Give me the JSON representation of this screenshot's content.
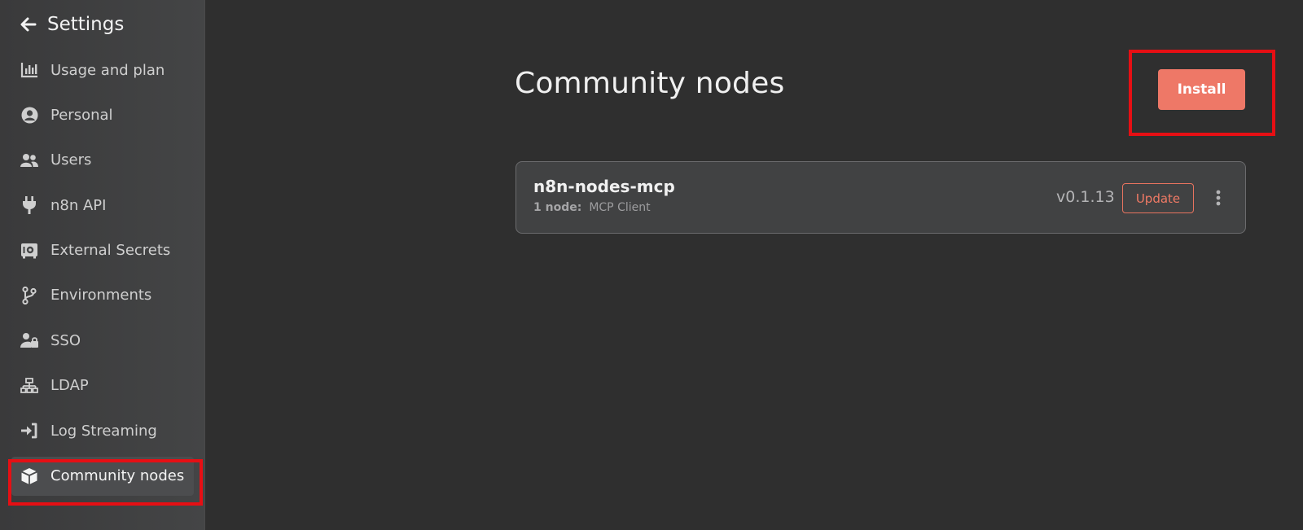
{
  "sidebar": {
    "title": "Settings",
    "back_icon": "arrow-left-icon",
    "items": [
      {
        "label": "Usage and plan",
        "icon": "bar-chart-icon"
      },
      {
        "label": "Personal",
        "icon": "user-circle-icon"
      },
      {
        "label": "Users",
        "icon": "users-icon"
      },
      {
        "label": "n8n API",
        "icon": "plug-icon"
      },
      {
        "label": "External Secrets",
        "icon": "vault-icon"
      },
      {
        "label": "Environments",
        "icon": "code-branch-icon"
      },
      {
        "label": "SSO",
        "icon": "user-lock-icon"
      },
      {
        "label": "LDAP",
        "icon": "network-icon"
      },
      {
        "label": "Log Streaming",
        "icon": "sign-in-icon"
      },
      {
        "label": "Community nodes",
        "icon": "cube-icon",
        "active": true
      }
    ]
  },
  "main": {
    "title": "Community nodes",
    "install_label": "Install",
    "packages": [
      {
        "name": "n8n-nodes-mcp",
        "node_count_label": "1 node:",
        "node_names": "MCP Client",
        "version": "v0.1.13",
        "update_label": "Update",
        "menu_icon": "ellipsis-vertical-icon"
      }
    ]
  },
  "colors": {
    "accent": "#ee7867",
    "highlight": "#e60f14",
    "background": "#2f2f2f",
    "sidebar": "#3f3f40"
  }
}
